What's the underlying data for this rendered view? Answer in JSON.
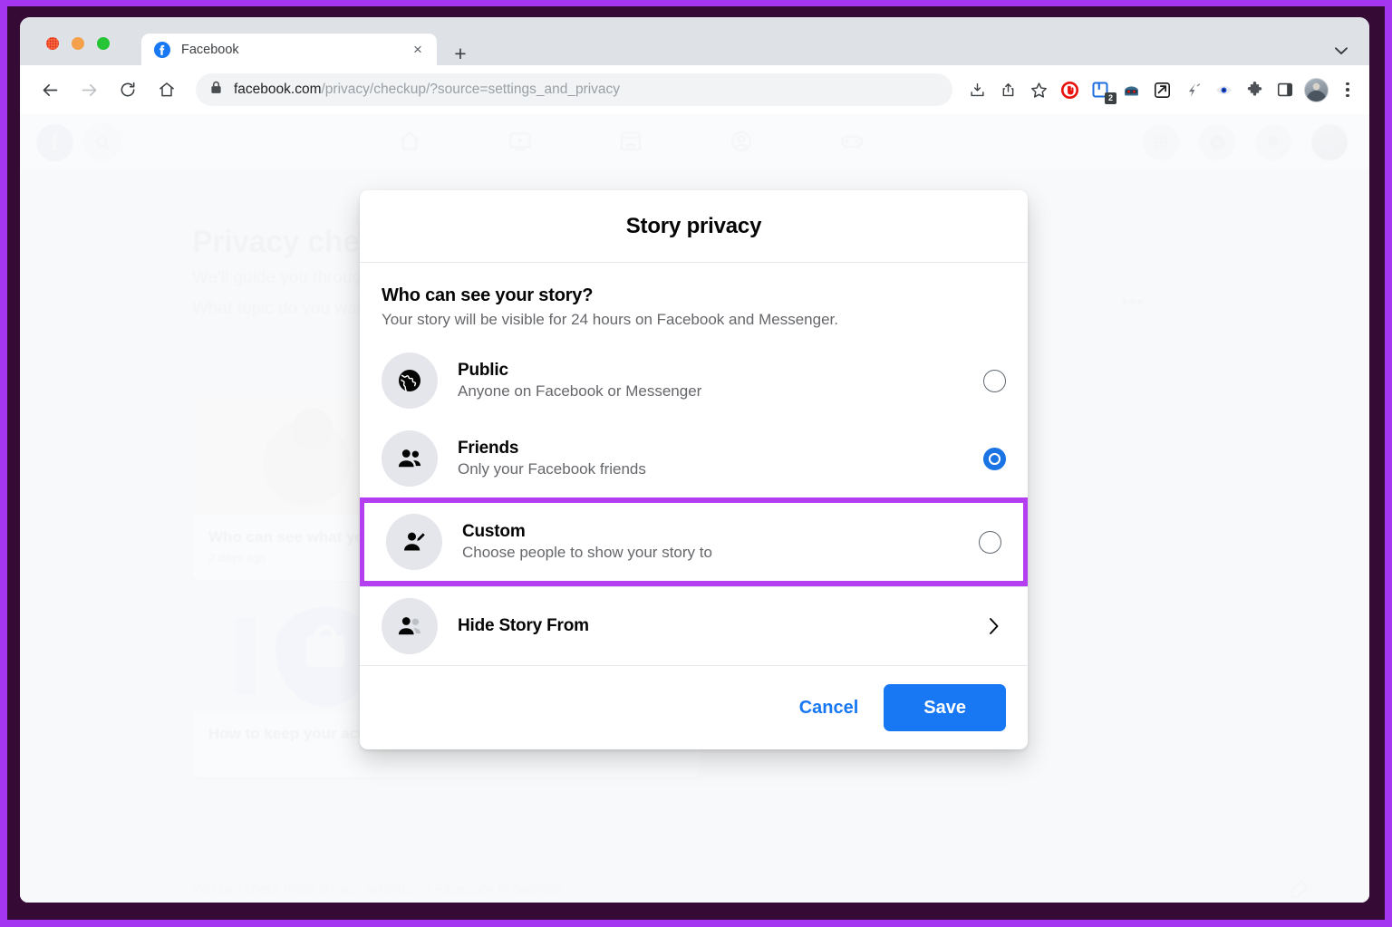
{
  "browser": {
    "window_controls": [
      "close",
      "minimize",
      "maximize"
    ],
    "tab": {
      "title": "Facebook",
      "favicon": "facebook-logo-icon",
      "close_label": "×"
    },
    "new_tab_label": "+",
    "tab_list_icon": "chevron-down-icon",
    "nav": {
      "back_icon": "back-arrow-icon",
      "forward_icon": "forward-arrow-icon",
      "reload_icon": "reload-icon",
      "home_icon": "home-icon"
    },
    "omnibox": {
      "lock_icon": "lock-icon",
      "url_domain": "facebook.com",
      "url_path": "/privacy/checkup/?source=settings_and_privacy",
      "full_url": "facebook.com/privacy/checkup/?source=settings_and_privacy"
    },
    "toolbar_icons": [
      {
        "name": "install-app-icon",
        "badge": ""
      },
      {
        "name": "share-icon",
        "badge": ""
      },
      {
        "name": "bookmark-star-icon",
        "badge": ""
      },
      {
        "name": "adblock-extension-icon",
        "badge": ""
      },
      {
        "name": "reader-extension-icon",
        "badge": "2"
      },
      {
        "name": "bot-extension-icon",
        "badge": ""
      },
      {
        "name": "send-extension-icon",
        "badge": ""
      },
      {
        "name": "lightning-extension-icon",
        "badge": ""
      },
      {
        "name": "eye-extension-icon",
        "badge": ""
      },
      {
        "name": "puzzle-extensions-icon",
        "badge": ""
      },
      {
        "name": "side-panel-icon",
        "badge": ""
      }
    ],
    "profile_avatar": "profile-avatar",
    "menu_icon": "three-dot-menu-icon"
  },
  "background_page": {
    "header": {
      "logo": "facebook-logo-icon",
      "search_icon": "search-icon",
      "nav_items": [
        "home-icon",
        "video-icon",
        "marketplace-icon",
        "groups-icon",
        "gaming-icon"
      ],
      "right_items": [
        "apps-grid-icon",
        "messenger-icon",
        "notifications-bell-icon",
        "account-avatar"
      ]
    },
    "title": "Privacy checkup",
    "subtitle_line1": "We'll guide you through some settings",
    "subtitle_line2": "What topic do you want to review?",
    "cards": [
      {
        "title": "Who can see what you share",
        "meta": "2 days ago"
      },
      {
        "title": "How to keep your account secure",
        "meta": ""
      }
    ],
    "more_options_icon": "ellipsis-icon",
    "footnote": "You can check more privacy settings on Facebook in Settings",
    "edit_icon": "edit-icon"
  },
  "modal": {
    "title": "Story privacy",
    "section": {
      "question": "Who can see your story?",
      "note": "Your story will be visible for 24 hours on Facebook and Messenger."
    },
    "options": [
      {
        "icon": "globe-icon",
        "label": "Public",
        "description": "Anyone on Facebook or Messenger",
        "control": "radio",
        "selected": false,
        "highlighted": false
      },
      {
        "icon": "friends-icon",
        "label": "Friends",
        "description": "Only your Facebook friends",
        "control": "radio",
        "selected": true,
        "highlighted": false
      },
      {
        "icon": "custom-person-edit-icon",
        "label": "Custom",
        "description": "Choose people to show your story to",
        "control": "radio",
        "selected": false,
        "highlighted": true
      },
      {
        "icon": "hide-people-icon",
        "label": "Hide Story From",
        "description": "",
        "control": "chevron",
        "selected": false,
        "highlighted": false
      }
    ],
    "footer": {
      "cancel_label": "Cancel",
      "save_label": "Save"
    }
  },
  "colors": {
    "annotation_purple": "#b43ff0",
    "annotation_frame_dark": "#350a35",
    "facebook_blue": "#1877f2",
    "radio_selected_blue": "#1b74e4",
    "text_primary": "#050505",
    "text_secondary": "#65676b",
    "icon_circle_grey": "#e4e6eb"
  }
}
